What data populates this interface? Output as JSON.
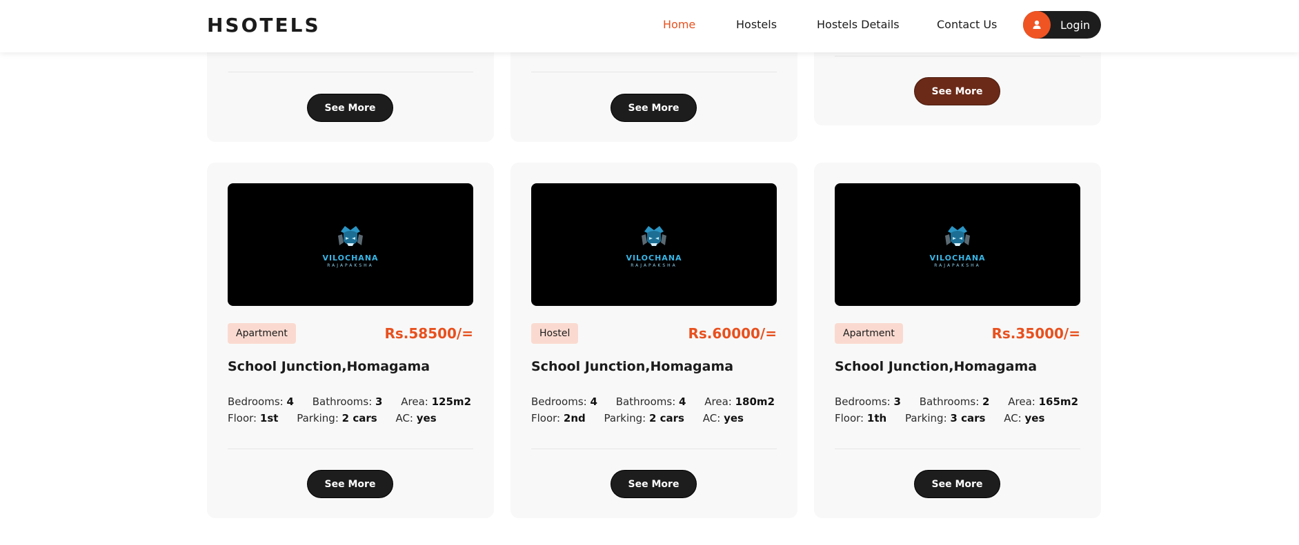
{
  "header": {
    "logo": "HSOTELS",
    "nav": [
      {
        "label": "Home",
        "active": true
      },
      {
        "label": "Hostels",
        "active": false
      },
      {
        "label": "Hostels Details",
        "active": false
      },
      {
        "label": "Contact Us",
        "active": false
      }
    ],
    "login_label": "Login"
  },
  "colors": {
    "accent": "#e8501e",
    "dark_button": "#1d1d1d",
    "highlight_button": "#6b2a18",
    "badge_bg": "#fadad0",
    "card_bg": "#f8f8f8"
  },
  "top_cards": [
    {
      "button_label": "See More"
    },
    {
      "button_label": "See More"
    },
    {
      "button_label": "See More",
      "hovered": true
    }
  ],
  "listings": [
    {
      "image_brand": "VILOCHANA",
      "image_sub": "RAJAPAKSHA",
      "type": "Apartment",
      "price": "Rs.58500/=",
      "location": "School Junction,Homagama",
      "bedrooms_label": "Bedrooms:",
      "bedrooms": "4",
      "bathrooms_label": "Bathrooms:",
      "bathrooms": "3",
      "area_label": "Area:",
      "area": "125m2",
      "floor_label": "Floor:",
      "floor": "1st",
      "parking_label": "Parking:",
      "parking": "2 cars",
      "ac_label": "AC:",
      "ac": "yes",
      "button_label": "See More"
    },
    {
      "image_brand": "VILOCHANA",
      "image_sub": "RAJAPAKSHA",
      "type": "Hostel",
      "price": "Rs.60000/=",
      "location": "School Junction,Homagama",
      "bedrooms_label": "Bedrooms:",
      "bedrooms": "4",
      "bathrooms_label": "Bathrooms:",
      "bathrooms": "4",
      "area_label": "Area:",
      "area": "180m2",
      "floor_label": "Floor:",
      "floor": "2nd",
      "parking_label": "Parking:",
      "parking": "2 cars",
      "ac_label": "AC:",
      "ac": "yes",
      "button_label": "See More"
    },
    {
      "image_brand": "VILOCHANA",
      "image_sub": "RAJAPAKSHA",
      "type": "Apartment",
      "price": "Rs.35000/=",
      "location": "School Junction,Homagama",
      "bedrooms_label": "Bedrooms:",
      "bedrooms": "3",
      "bathrooms_label": "Bathrooms:",
      "bathrooms": "2",
      "area_label": "Area:",
      "area": "165m2",
      "floor_label": "Floor:",
      "floor": "1th",
      "parking_label": "Parking:",
      "parking": "3 cars",
      "ac_label": "AC:",
      "ac": "yes",
      "button_label": "See More"
    }
  ]
}
